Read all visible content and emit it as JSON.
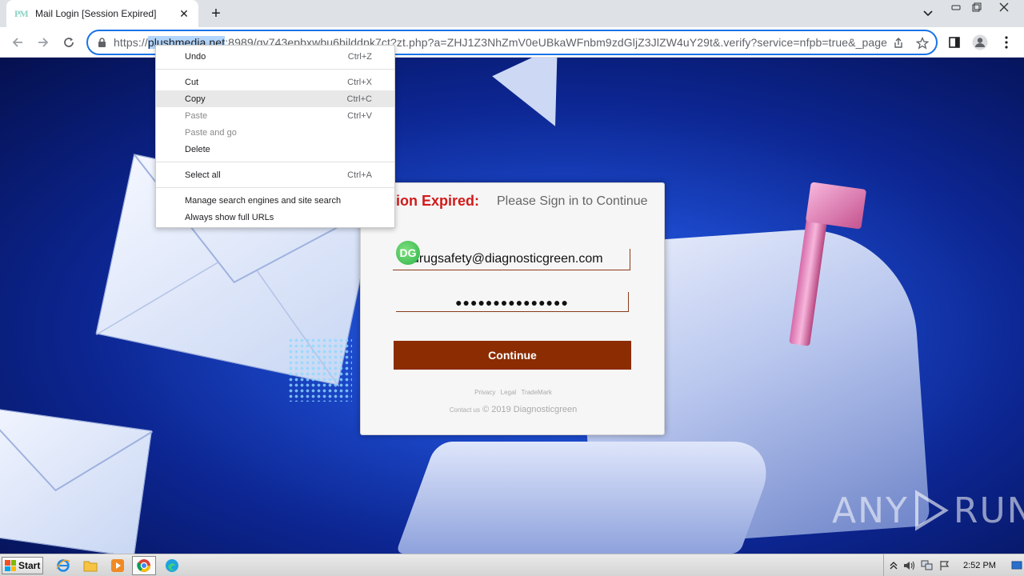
{
  "browser": {
    "tab_title": "Mail Login [Session Expired]",
    "tab_favicon_text": "PM",
    "url_prefix": "https://",
    "url_selected": "plushmedia.net",
    "url_rest": ":8989/gy743epbxwbu6bilddpk7ct?zt.php?a=ZHJ1Z3NhZmV0eUBkaWFnbm9zdGljZ3JlZW4uY29t&.verify?service=nfpb=true&_pageLa"
  },
  "context_menu": {
    "items": [
      {
        "label": "Undo",
        "shortcut": "Ctrl+Z",
        "disabled": false
      },
      {
        "label": "Cut",
        "shortcut": "Ctrl+X",
        "disabled": false
      },
      {
        "label": "Copy",
        "shortcut": "Ctrl+C",
        "disabled": false
      },
      {
        "label": "Paste",
        "shortcut": "Ctrl+V",
        "disabled": true
      },
      {
        "label": "Paste and go",
        "shortcut": "",
        "disabled": true
      },
      {
        "label": "Delete",
        "shortcut": "",
        "disabled": false
      },
      {
        "label": "Select all",
        "shortcut": "Ctrl+A",
        "disabled": false
      },
      {
        "label": "Manage search engines and site search",
        "shortcut": "",
        "disabled": false
      },
      {
        "label": "Always show full URLs",
        "shortcut": "",
        "disabled": false
      }
    ]
  },
  "login": {
    "heading_red": "ssion Expired:",
    "heading_sub": "Please Sign in to Continue",
    "avatar_text": "DG",
    "email_value": "drugsafety@diagnosticgreen.com",
    "password_mask": "●●●●●●●●●●●●●●●",
    "continue_label": "Continue",
    "footer_links": [
      "Privacy",
      "Legal",
      "TradeMark"
    ],
    "footer_contact": "Contact us",
    "footer_copyright": "© 2019 Diagnosticgreen"
  },
  "watermark": {
    "left": "ANY",
    "right": "RUN"
  },
  "taskbar": {
    "start_label": "Start",
    "clock": "2:52 PM"
  },
  "colors": {
    "accent_blue": "#1a73e8",
    "error_red": "#d21a1a",
    "button_brown": "#8b2c02"
  }
}
